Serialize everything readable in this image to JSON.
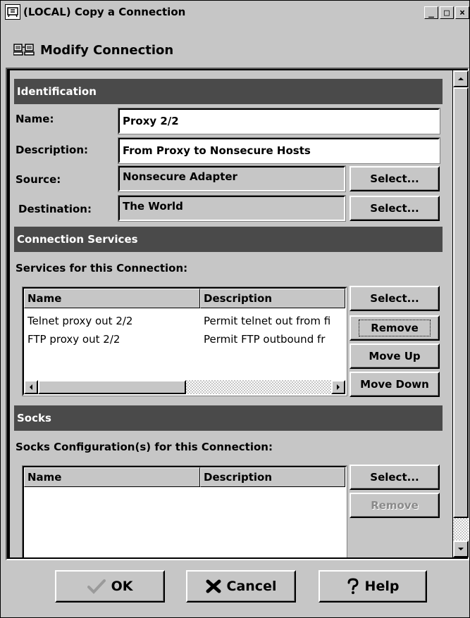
{
  "window": {
    "title": "(LOCAL) Copy a Connection",
    "app_icon": "network-app-icon",
    "controls": {
      "minimize": "_",
      "maximize": "□",
      "close": "×"
    }
  },
  "header": {
    "icon": "network-computers-icon",
    "title": "Modify Connection"
  },
  "identification": {
    "section_title": "Identification",
    "name_label": "Name:",
    "name_value": "Proxy 2/2",
    "description_label": "Description:",
    "description_value": "From Proxy to Nonsecure Hosts",
    "source_label": "Source:",
    "source_value": "Nonsecure Adapter",
    "source_select": "Select...",
    "destination_label": "Destination:",
    "destination_value": "The World",
    "destination_select": "Select..."
  },
  "connection_services": {
    "section_title": "Connection Services",
    "subtitle": "Services for this Connection:",
    "columns": [
      "Name",
      "Description"
    ],
    "rows": [
      {
        "name": "Telnet proxy out 2/2",
        "description": "Permit telnet out from fi"
      },
      {
        "name": "FTP proxy out 2/2",
        "description": "Permit FTP outbound fr"
      }
    ],
    "buttons": {
      "select": "Select...",
      "remove": "Remove",
      "move_up": "Move Up",
      "move_down": "Move Down"
    }
  },
  "socks": {
    "section_title": "Socks",
    "subtitle": "Socks Configuration(s) for this Connection:",
    "columns": [
      "Name",
      "Description"
    ],
    "rows": [],
    "buttons": {
      "select": "Select...",
      "remove": "Remove"
    }
  },
  "footer": {
    "ok": "OK",
    "cancel": "Cancel",
    "help": "Help"
  },
  "colors": {
    "window_bg": "#c6c6c6",
    "section_bar": "#4a4a4a",
    "section_text": "#ffffff",
    "disabled_text": "#8a8a8a"
  }
}
